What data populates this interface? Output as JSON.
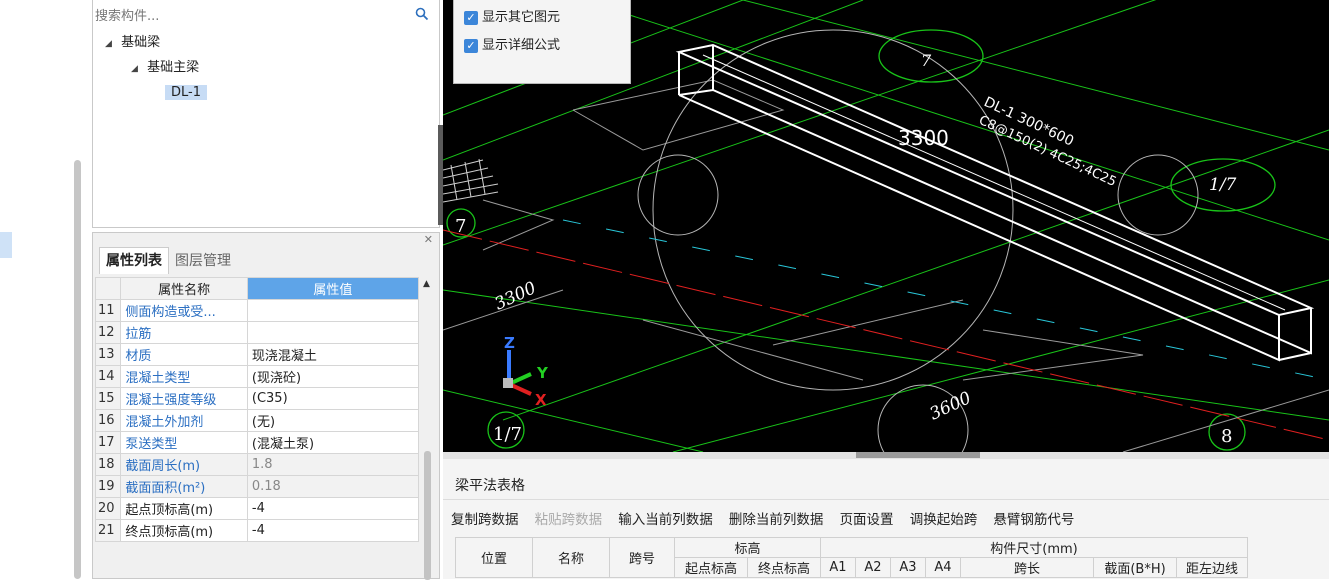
{
  "tree": {
    "search_placeholder": "搜索构件...",
    "nodes": [
      {
        "label": "基础梁",
        "level": 0
      },
      {
        "label": "基础主梁",
        "level": 1
      },
      {
        "label": "DL-1",
        "level": 2,
        "selected": true
      }
    ]
  },
  "props": {
    "tabs": [
      "属性列表",
      "图层管理"
    ],
    "headers": {
      "name": "属性名称",
      "value": "属性值"
    },
    "rows": [
      {
        "num": "11",
        "name": "侧面构造或受...",
        "value": ""
      },
      {
        "num": "12",
        "name": "拉筋",
        "value": ""
      },
      {
        "num": "13",
        "name": "材质",
        "value": "现浇混凝土"
      },
      {
        "num": "14",
        "name": "混凝土类型",
        "value": "(现浇砼)"
      },
      {
        "num": "15",
        "name": "混凝土强度等级",
        "value": "(C35)"
      },
      {
        "num": "16",
        "name": "混凝土外加剂",
        "value": "(无)"
      },
      {
        "num": "17",
        "name": "泵送类型",
        "value": "(混凝土泵)"
      },
      {
        "num": "18",
        "name": "截面周长(m)",
        "value": "1.8"
      },
      {
        "num": "19",
        "name": "截面面积(m²)",
        "value": "0.18"
      },
      {
        "num": "20",
        "name": "起点顶标高(m)",
        "value": "-4"
      },
      {
        "num": "21",
        "name": "终点顶标高(m)",
        "value": "-4"
      }
    ]
  },
  "viewport": {
    "options": [
      "显示其它图元",
      "显示详细公式"
    ],
    "labels": {
      "dim_a": "3300",
      "dim_b": "3300",
      "dim_c": "3600",
      "beam_label_1": "DL-1 300*600",
      "beam_label_2": "C8@150(2) 4C25;4C25",
      "axis_left": "7",
      "axis_ratio": "1/7",
      "axis_ratio_right": "1/7",
      "axis_right": "8",
      "axis_top_right": "7",
      "axis_z": "Z",
      "axis_y": "Y",
      "axis_x": "X"
    },
    "colors": {
      "background": "#000000",
      "beam": "#ffffff",
      "grid_green": "#19c319",
      "axis_red": "#e02020",
      "cyan": "#29c6d8"
    }
  },
  "beam_table": {
    "title": "梁平法表格",
    "toolbar": [
      {
        "label": "复制跨数据",
        "enabled": true
      },
      {
        "label": "粘贴跨数据",
        "enabled": false
      },
      {
        "label": "输入当前列数据",
        "enabled": true
      },
      {
        "label": "删除当前列数据",
        "enabled": true
      },
      {
        "label": "页面设置",
        "enabled": true
      },
      {
        "label": "调换起始跨",
        "enabled": true
      },
      {
        "label": "悬臂钢筋代号",
        "enabled": true
      }
    ],
    "headers": {
      "position": "位置",
      "name": "名称",
      "span_no": "跨号",
      "elevation": "标高",
      "elev_start": "起点标高",
      "elev_end": "终点标高",
      "size": "构件尺寸(mm)",
      "a1": "A1",
      "a2": "A2",
      "a3": "A3",
      "a4": "A4",
      "span_len": "跨长",
      "section": "截面(B*H)",
      "left_dist": "距左边线"
    }
  }
}
